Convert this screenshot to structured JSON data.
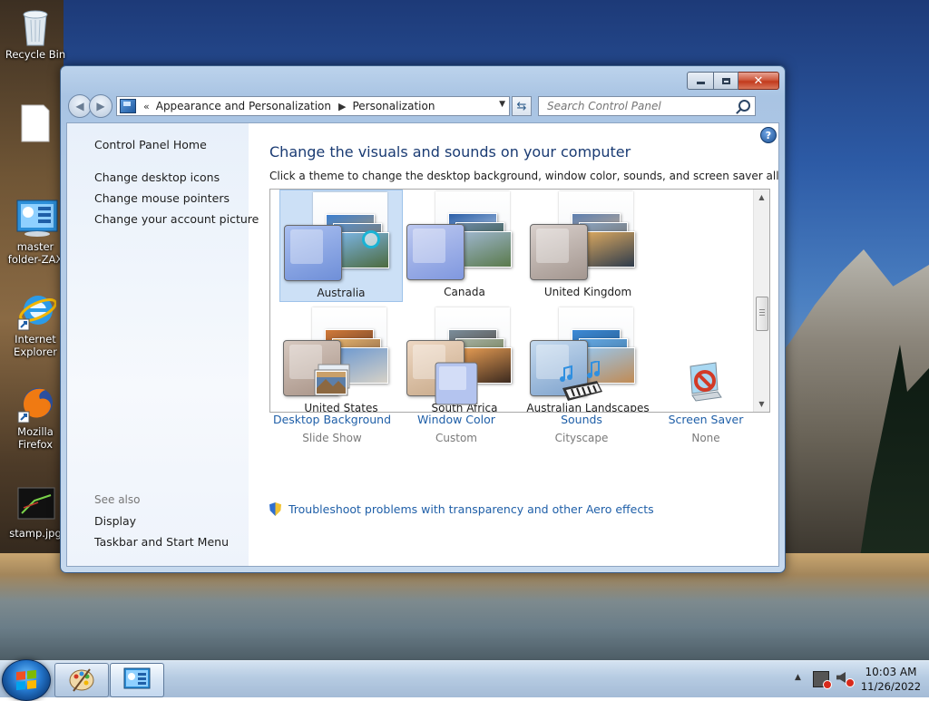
{
  "desktop": {
    "icons": [
      {
        "label": "Recycle Bin"
      },
      {
        "label": ""
      },
      {
        "label": "master folder-ZAX"
      },
      {
        "label": "Internet Explorer"
      },
      {
        "label": "Mozilla Firefox"
      },
      {
        "label": "stamp.jpg"
      }
    ]
  },
  "window": {
    "address": {
      "prefix": "«",
      "crumbs": [
        "Appearance and Personalization",
        "Personalization"
      ]
    },
    "search": {
      "placeholder": "Search Control Panel"
    },
    "left_pane": {
      "home": "Control Panel Home",
      "links": [
        "Change desktop icons",
        "Change mouse pointers",
        "Change your account picture"
      ],
      "see_also_label": "See also",
      "see_also_links": [
        "Display",
        "Taskbar and Start Menu"
      ]
    },
    "main": {
      "title": "Change the visuals and sounds on your computer",
      "subtitle": "Click a theme to change the desktop background, window color, sounds, and screen saver all at once.",
      "themes": [
        {
          "name": "Australia",
          "selected": true
        },
        {
          "name": "Canada",
          "selected": false
        },
        {
          "name": "United Kingdom",
          "selected": false
        },
        {
          "name": "United States",
          "selected": false
        },
        {
          "name": "South Africa",
          "selected": false
        },
        {
          "name": "Australian Landscapes",
          "selected": false
        }
      ],
      "options": [
        {
          "title": "Desktop Background",
          "value": "Slide Show",
          "icon": "desktop-background-icon"
        },
        {
          "title": "Window Color",
          "value": "Custom",
          "icon": "window-color-icon"
        },
        {
          "title": "Sounds",
          "value": "Cityscape",
          "icon": "sounds-icon"
        },
        {
          "title": "Screen Saver",
          "value": "None",
          "icon": "screen-saver-icon"
        }
      ],
      "troubleshoot": "Troubleshoot problems with transparency and other Aero effects"
    }
  },
  "taskbar": {
    "clock_time": "10:03 AM",
    "clock_date": "11/26/2022"
  },
  "colors": {
    "link": "#1f5fa8",
    "title": "#1a3b73",
    "selection": "#cce0f6"
  }
}
